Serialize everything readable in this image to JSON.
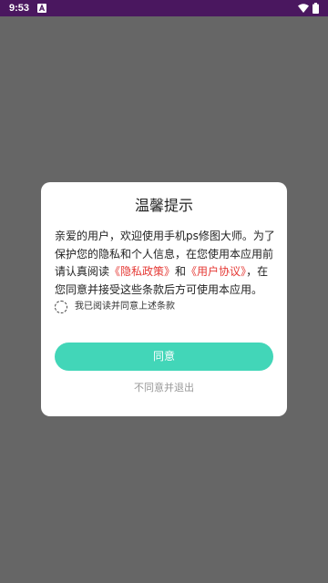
{
  "status_bar": {
    "time": "9:53",
    "background": "#4a175f",
    "icons": [
      "notification-a-icon",
      "wifi-icon",
      "battery-icon"
    ]
  },
  "dialog": {
    "title": "温馨提示",
    "body": {
      "text_before": "亲爱的用户，欢迎使用手机ps修图大师。为了保护您的隐私和个人信息，在您使用本应用前请认真阅读",
      "privacy_link": "《隐私政策》",
      "and_text": "和",
      "user_agreement_link": "《用户协议》",
      "text_after": "，在您同意并接受这些条款后方可使用本应用。"
    },
    "checkbox_label": "我已阅读并同意上述条款",
    "checkbox_checked": false,
    "agree_button": "同意",
    "decline_button": "不同意并退出"
  },
  "colors": {
    "accent": "#42d6b8",
    "link": "#e53935",
    "overlay": "#666666"
  }
}
